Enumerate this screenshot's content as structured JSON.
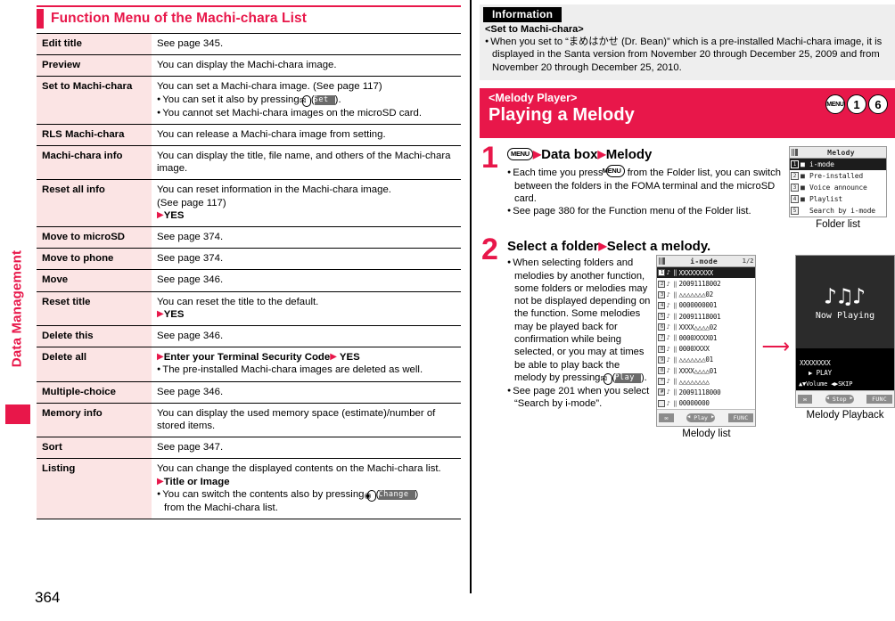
{
  "page": {
    "number": "364",
    "side_tab": "Data Management"
  },
  "left": {
    "section_title": "Function Menu of the Machi-chara List",
    "rows": [
      {
        "key": "Edit title",
        "lines": [
          {
            "t": "See page 345."
          }
        ]
      },
      {
        "key": "Preview",
        "lines": [
          {
            "t": "You can display the Machi-chara image."
          }
        ]
      },
      {
        "key": "Set to Machi-chara",
        "lines": [
          {
            "t": "You can set a Machi-chara image. (See page 117)"
          },
          {
            "bullet": true,
            "t": "You can set it also by pressing ",
            "key_icon": "✉",
            "chip": "Set",
            "after": "."
          },
          {
            "bullet": true,
            "t": "You cannot set Machi-chara images on the microSD card."
          }
        ]
      },
      {
        "key": "RLS Machi-chara",
        "lines": [
          {
            "t": "You can release a Machi-chara image from setting."
          }
        ]
      },
      {
        "key": "Machi-chara info",
        "lines": [
          {
            "t": "You can display the title, file name, and others of the Machi-chara image."
          }
        ]
      },
      {
        "key": "Reset all info",
        "lines": [
          {
            "t": "You can reset information in the Machi-chara image."
          },
          {
            "t": "(See page 117)"
          },
          {
            "arrow": true,
            "bold": true,
            "t": "YES"
          }
        ]
      },
      {
        "key": "Move to microSD",
        "lines": [
          {
            "t": "See page 374."
          }
        ]
      },
      {
        "key": "Move to phone",
        "lines": [
          {
            "t": "See page 374."
          }
        ]
      },
      {
        "key": "Move",
        "lines": [
          {
            "t": "See page 346."
          }
        ]
      },
      {
        "key": "Reset title",
        "lines": [
          {
            "t": "You can reset the title to the default."
          },
          {
            "arrow": true,
            "bold": true,
            "t": "YES"
          }
        ]
      },
      {
        "key": "Delete this",
        "lines": [
          {
            "t": "See page 346."
          }
        ]
      },
      {
        "key": "Delete all",
        "lines": [
          {
            "arrow": true,
            "bold": true,
            "t": "Enter your Terminal Security Code",
            "arrow2": true,
            "t2": "YES"
          },
          {
            "bullet": true,
            "t": "The pre-installed Machi-chara images are deleted as well."
          }
        ]
      },
      {
        "key": "Multiple-choice",
        "lines": [
          {
            "t": "See page 346."
          }
        ]
      },
      {
        "key": "Memory info",
        "lines": [
          {
            "t": "You can display the used memory space (estimate)/number of stored items."
          }
        ]
      },
      {
        "key": "Sort",
        "lines": [
          {
            "t": "See page 347."
          }
        ]
      },
      {
        "key": "Listing",
        "lines": [
          {
            "t": "You can change the displayed contents on the Machi-chara list."
          },
          {
            "arrow": true,
            "bold": true,
            "t": "Title or Image"
          },
          {
            "bullet": true,
            "t": "You can switch the contents also by pressing ",
            "key_icon": "◉",
            "chip": "Change",
            "after": ")",
            "tail": "from the Machi-chara list."
          }
        ]
      }
    ]
  },
  "right": {
    "info": {
      "tag": "Information",
      "subtitle": "<Set to Machi-chara>",
      "body": "When you set to “まめはかせ (Dr. Bean)” which is a pre-installed Machi-chara image, it is displayed in the Santa version from November 20 through December 25, 2009 and from November 20 through December 25, 2010."
    },
    "banner": {
      "sub": "<Melody Player>",
      "main": "Playing a Melody",
      "keys": [
        "MENU",
        "1",
        "6"
      ]
    },
    "steps": [
      {
        "num": "1",
        "title_menu_key": "MENU",
        "title_parts": [
          "Data box",
          "Melody"
        ],
        "bullets": [
          "Each time you press Ⓜ from the Folder list, you can switch between the folders in the FOMA terminal and the microSD card.",
          "See page 380 for the Function menu of the Folder list."
        ],
        "bullet1_pre": "Each time you press ",
        "bullet1_post": " from the Folder list, you can switch between the folders in the FOMA terminal and the microSD card.",
        "bullet2": "See page 380 for the Function menu of the Folder list."
      },
      {
        "num": "2",
        "title_parts": [
          "Select a folder",
          "Select a melody."
        ],
        "bullet1": "When selecting folders and melodies by another function, some folders or melodies may not be displayed depending on the function. Some melodies may be played back for confirmation while being selected, or you may at times be able to play back the melody by pressing ",
        "bullet1_chip": "Play",
        "bullet1_tail": ").",
        "bullet2": "See page 201 when you select “Search by i-mode”."
      }
    ],
    "folder_list": {
      "caption": "Folder list",
      "title": "Melody",
      "items": [
        {
          "idx": "1",
          "icon": "■",
          "label": "i-mode",
          "selected": true
        },
        {
          "idx": "2",
          "icon": "■",
          "label": "Pre-installed",
          "selected": false
        },
        {
          "idx": "3",
          "icon": "■",
          "label": "Voice announce",
          "selected": false
        },
        {
          "idx": "4",
          "icon": "■",
          "label": "Playlist",
          "selected": false
        },
        {
          "idx": "5",
          "icon": "",
          "label": "Search by i-mode",
          "selected": false
        }
      ]
    },
    "melody_list": {
      "caption": "Melody list",
      "title": "i-mode",
      "page": "1/2",
      "items": [
        {
          "idx": "1",
          "label": "XXXXXXXXX",
          "selected": true
        },
        {
          "idx": "2",
          "label": "20091118002",
          "selected": false
        },
        {
          "idx": "3",
          "label": "△△△△△△△02",
          "selected": false
        },
        {
          "idx": "4",
          "label": "0000000001",
          "selected": false
        },
        {
          "idx": "5",
          "label": "20091118001",
          "selected": false
        },
        {
          "idx": "6",
          "label": "XXXX△△△△02",
          "selected": false
        },
        {
          "idx": "7",
          "label": "0000XXXX01",
          "selected": false
        },
        {
          "idx": "8",
          "label": "0000XXXX",
          "selected": false
        },
        {
          "idx": "9",
          "label": "△△△△△△△01",
          "selected": false
        },
        {
          "idx": "0",
          "label": "XXXX△△△△01",
          "selected": false
        },
        {
          "idx": "*",
          "label": "△△△△△△△△",
          "selected": false
        },
        {
          "idx": "#",
          "label": "20091118000",
          "selected": false
        },
        {
          "idx": "",
          "label": "00000000",
          "selected": false
        }
      ],
      "soft_left": "✉",
      "soft_center": "Play",
      "soft_right": "FUNC"
    },
    "playback": {
      "caption": "Melody Playback",
      "art_text": "Now Playing",
      "notes": "♪♫♪",
      "track": "XXXXXXXX",
      "state": "▶ PLAY",
      "controls": "▲▼Volume ◀▶SKIP",
      "soft_left": "✉",
      "soft_center": "Stop",
      "soft_right": "FUNC"
    },
    "transition_arrow": "⟶"
  },
  "colors": {
    "accent": "#e8174a",
    "key_cell_bg": "#fbe4e4",
    "info_bg": "#eeeeee"
  }
}
